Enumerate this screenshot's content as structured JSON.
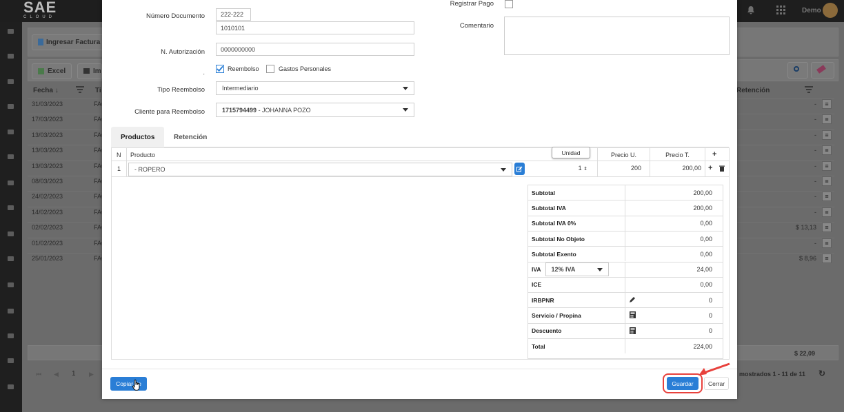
{
  "app": {
    "logo_text": "SAE",
    "logo_sub": "CLOUD",
    "user": "Demo",
    "sidebar_icons": [
      "users-icon",
      "handshake-icon",
      "network-icon",
      "truck-icon",
      "chart-icon",
      "coins-icon",
      "table-icon",
      "shield-icon",
      "cart-icon",
      "person-icon",
      "book-icon",
      "list-icon",
      "list2-icon",
      "inbox-icon",
      "building-icon"
    ]
  },
  "background": {
    "card_title": "Ingresar Factura P",
    "export_excel": "Excel",
    "export_print": "Im",
    "col_fecha": "Fecha",
    "col_sort": "↓",
    "col_tipo": "Ti",
    "col_retencion": "Retención",
    "rows": [
      {
        "fecha": "31/03/2023",
        "tipo": "FAC",
        "ret": "-"
      },
      {
        "fecha": "17/03/2023",
        "tipo": "FAC",
        "ret": "-"
      },
      {
        "fecha": "13/03/2023",
        "tipo": "FAC",
        "ret": "-"
      },
      {
        "fecha": "13/03/2023",
        "tipo": "FAC",
        "ret": "-"
      },
      {
        "fecha": "13/03/2023",
        "tipo": "FAC",
        "ret": "-"
      },
      {
        "fecha": "08/03/2023",
        "tipo": "FAC",
        "ret": "-"
      },
      {
        "fecha": "24/02/2023",
        "tipo": "FAC",
        "ret": "-"
      },
      {
        "fecha": "14/02/2023",
        "tipo": "FAC",
        "ret": "-"
      },
      {
        "fecha": "02/02/2023",
        "tipo": "FAC",
        "ret": "$ 13,13"
      },
      {
        "fecha": "01/02/2023",
        "tipo": "FAC",
        "ret": "-"
      },
      {
        "fecha": "25/01/2023",
        "tipo": "FAC",
        "ret": "$ 8,96"
      }
    ],
    "total_ret": "$ 22,09",
    "page": "1",
    "pagination_info": "mostrados 1 - 11 de 11"
  },
  "form": {
    "numero_documento_label": "Número Documento",
    "serie": "222-222",
    "secuencial": "1010101",
    "autorizacion_label": "N. Autorización",
    "autorizacion": "0000000000",
    "dot_label": ".",
    "reembolso_label": "Reembolso",
    "gastos_label": "Gastos Personales",
    "tipo_reembolso_label": "Tipo Reembolso",
    "tipo_reembolso": "Intermediario",
    "cliente_label": "Cliente para Reembolso",
    "cliente_id": "1715794499",
    "cliente_name": " - JOHANNA POZO",
    "registrar_pago_label": "Registrar Pago",
    "comentario_label": "Comentario",
    "comentario": ""
  },
  "tabs": [
    {
      "label": "Productos",
      "active": true
    },
    {
      "label": "Retención",
      "active": false
    }
  ],
  "products": {
    "col_n": "N",
    "col_producto": "Producto",
    "col_unidad": "Unidad",
    "col_precio_u": "Precio U.",
    "col_precio_t": "Precio T.",
    "add": "+",
    "rows": [
      {
        "n": "1",
        "producto": "- ROPERO",
        "cantidad": "1",
        "precio_u": "200",
        "precio_t": "200,00"
      }
    ]
  },
  "totals": [
    {
      "label": "Subtotal",
      "value": "200,00"
    },
    {
      "label": "Subtotal IVA",
      "value": "200,00"
    },
    {
      "label": "Subtotal IVA 0%",
      "value": "0,00"
    },
    {
      "label": "Subtotal No Objeto",
      "value": "0,00"
    },
    {
      "label": "Subtotal Exento",
      "value": "0,00"
    },
    {
      "label": "IVA",
      "value": "24,00",
      "select": "12% IVA"
    },
    {
      "label": "ICE",
      "value": "0,00"
    },
    {
      "label": "IRBPNR",
      "value": "0",
      "icon": "pencil-icon"
    },
    {
      "label": "Servicio / Propina",
      "value": "0",
      "icon": "calculator-icon"
    },
    {
      "label": "Descuento",
      "value": "0",
      "icon": "calculator-icon"
    },
    {
      "label": "Total",
      "value": "224,00"
    }
  ],
  "footer": {
    "copiar": "Copiar de",
    "guardar": "Guardar",
    "cerrar": "Cerrar"
  },
  "colors": {
    "primary": "#2a7ed6",
    "highlight": "#e8413c",
    "checkbox": "#2a7ed6"
  }
}
